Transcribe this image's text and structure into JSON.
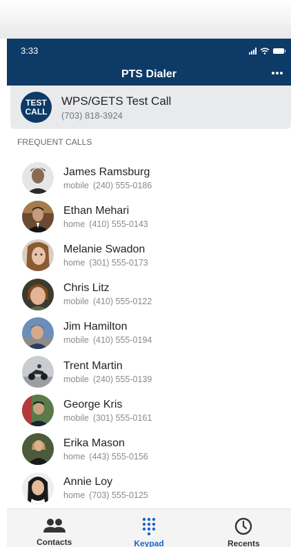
{
  "status_bar": {
    "time": "3:33"
  },
  "app_bar": {
    "title": "PTS Dialer"
  },
  "test_call": {
    "badge_line1": "TEST",
    "badge_line2": "CALL",
    "title": "WPS/GETS Test Call",
    "number": "(703) 818-3924"
  },
  "frequent": {
    "label": "FREQUENT CALLS",
    "contacts": [
      {
        "name": "James Ramsburg",
        "type": "mobile",
        "number": "(240) 555-0186"
      },
      {
        "name": "Ethan Mehari",
        "type": "home",
        "number": "(410) 555-0143"
      },
      {
        "name": "Melanie Swadon",
        "type": "home",
        "number": "(301) 555-0173"
      },
      {
        "name": "Chris Litz",
        "type": "mobile",
        "number": "(410) 555-0122"
      },
      {
        "name": "Jim Hamilton",
        "type": "mobile",
        "number": "(410) 555-0194"
      },
      {
        "name": "Trent Martin",
        "type": "mobile",
        "number": "(240) 555-0139"
      },
      {
        "name": "George Kris",
        "type": "mobile",
        "number": "(301) 555-0161"
      },
      {
        "name": "Erika Mason",
        "type": "home",
        "number": "(443) 555-0156"
      },
      {
        "name": "Annie Loy",
        "type": "home",
        "number": "(703) 555-0125"
      }
    ]
  },
  "tabs": {
    "contacts": "Contacts",
    "keypad": "Keypad",
    "recents": "Recents"
  },
  "colors": {
    "brand_navy": "#0d3a66",
    "active_tab": "#1a63c9"
  }
}
